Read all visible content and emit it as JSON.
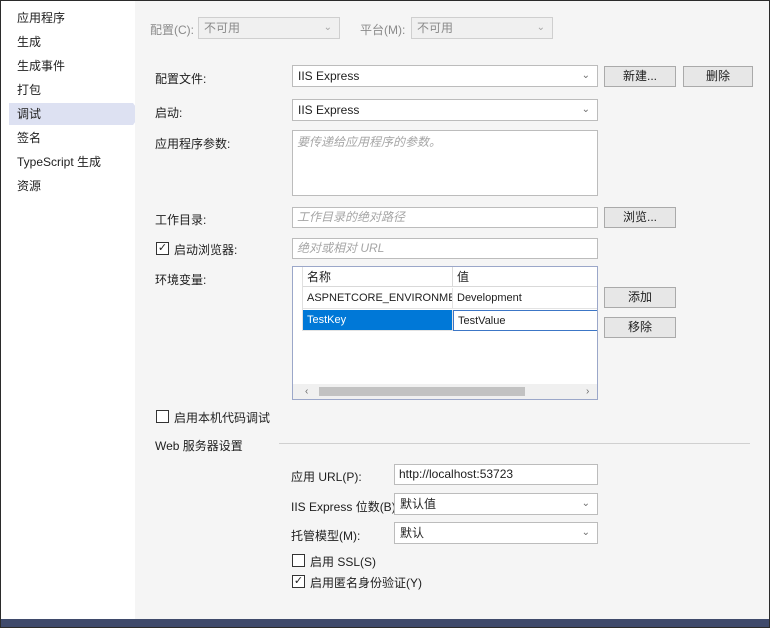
{
  "sidebar": {
    "items": [
      {
        "label": "应用程序"
      },
      {
        "label": "生成"
      },
      {
        "label": "生成事件"
      },
      {
        "label": "打包"
      },
      {
        "label": "调试"
      },
      {
        "label": "签名"
      },
      {
        "label": "TypeScript 生成"
      },
      {
        "label": "资源"
      }
    ],
    "active_index": 4
  },
  "top": {
    "config_label": "配置(C):",
    "config_value": "不可用",
    "platform_label": "平台(M):",
    "platform_value": "不可用"
  },
  "profile": {
    "label": "配置文件:",
    "value": "IIS Express",
    "new_button": "新建...",
    "delete_button": "删除"
  },
  "launch": {
    "label": "启动:",
    "value": "IIS Express"
  },
  "app_args": {
    "label": "应用程序参数:",
    "placeholder": "要传递给应用程序的参数。"
  },
  "working_dir": {
    "label": "工作目录:",
    "placeholder": "工作目录的绝对路径",
    "browse_button": "浏览..."
  },
  "launch_browser": {
    "label": "启动浏览器:",
    "checked": true,
    "placeholder": "绝对或相对 URL"
  },
  "env_vars": {
    "label": "环境变量:",
    "columns": [
      "名称",
      "值"
    ],
    "rows": [
      {
        "name": "ASPNETCORE_ENVIRONMENT",
        "value": "Development"
      },
      {
        "name": "TestKey",
        "value": "TestValue"
      }
    ],
    "add_button": "添加",
    "remove_button": "移除"
  },
  "native_debug": {
    "label": "启用本机代码调试",
    "checked": false
  },
  "web_server": {
    "section_title": "Web 服务器设置",
    "app_url_label": "应用 URL(P):",
    "app_url_value": "http://localhost:53723",
    "bitness_label": "IIS Express 位数(B):",
    "bitness_value": "默认值",
    "hosting_label": "托管模型(M):",
    "hosting_value": "默认",
    "ssl_label": "启用 SSL(S)",
    "ssl_checked": false,
    "anon_label": "启用匿名身份验证(Y)",
    "anon_checked": true
  },
  "colors": {
    "accent": "#0078d7",
    "nav_active": "#dde1f2",
    "bottom_bar": "#3f4a6b"
  }
}
